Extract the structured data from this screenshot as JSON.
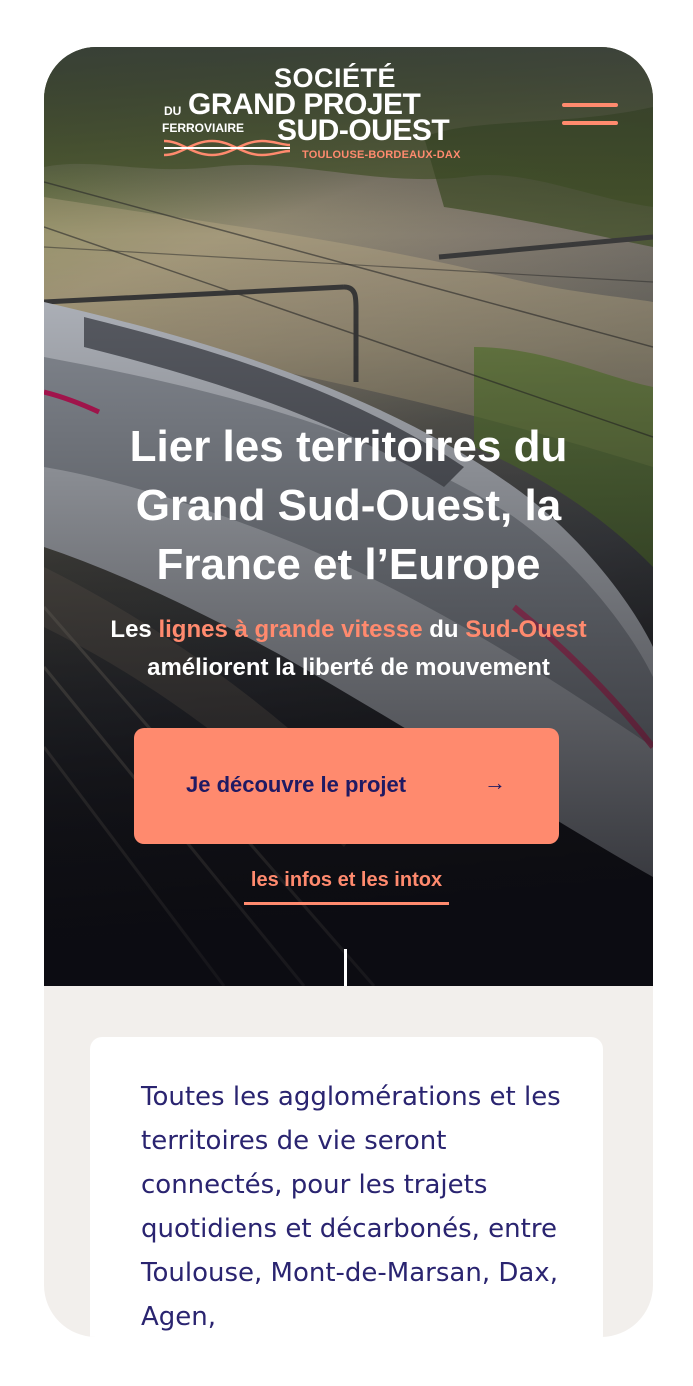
{
  "logo": {
    "line1": "SOCIÉTÉ",
    "du": "DU",
    "line2": "GRAND PROJET",
    "ferroviaire": "FERROVIAIRE",
    "line3": "SUD-OUEST",
    "tagline": "TOULOUSE-BORDEAUX-DAX"
  },
  "header": {
    "menu_icon": "hamburger-menu-icon"
  },
  "hero": {
    "headline": "Lier les territoires du Grand Sud-Ouest, la France et l’Europe",
    "sub": {
      "part1": "Les ",
      "highlight1": "lignes à grande vitesse",
      "part2": " du ",
      "highlight2": "Sud-Ouest",
      "part3": " améliorent la liberté de mouvement"
    },
    "cta_label": "Je découvre le projet",
    "cta_arrow": "→",
    "secondary_link": "les infos et les intox"
  },
  "intro": {
    "text": "Toutes les agglomérations et les territoires de vie seront connectés, pour les trajets quotidiens et décarbonés, entre Toulouse, Mont-de-Marsan, Dax, Agen,"
  },
  "colors": {
    "accent": "#ff8a6e",
    "navy": "#2a2470",
    "page_bg": "#f2efec"
  }
}
